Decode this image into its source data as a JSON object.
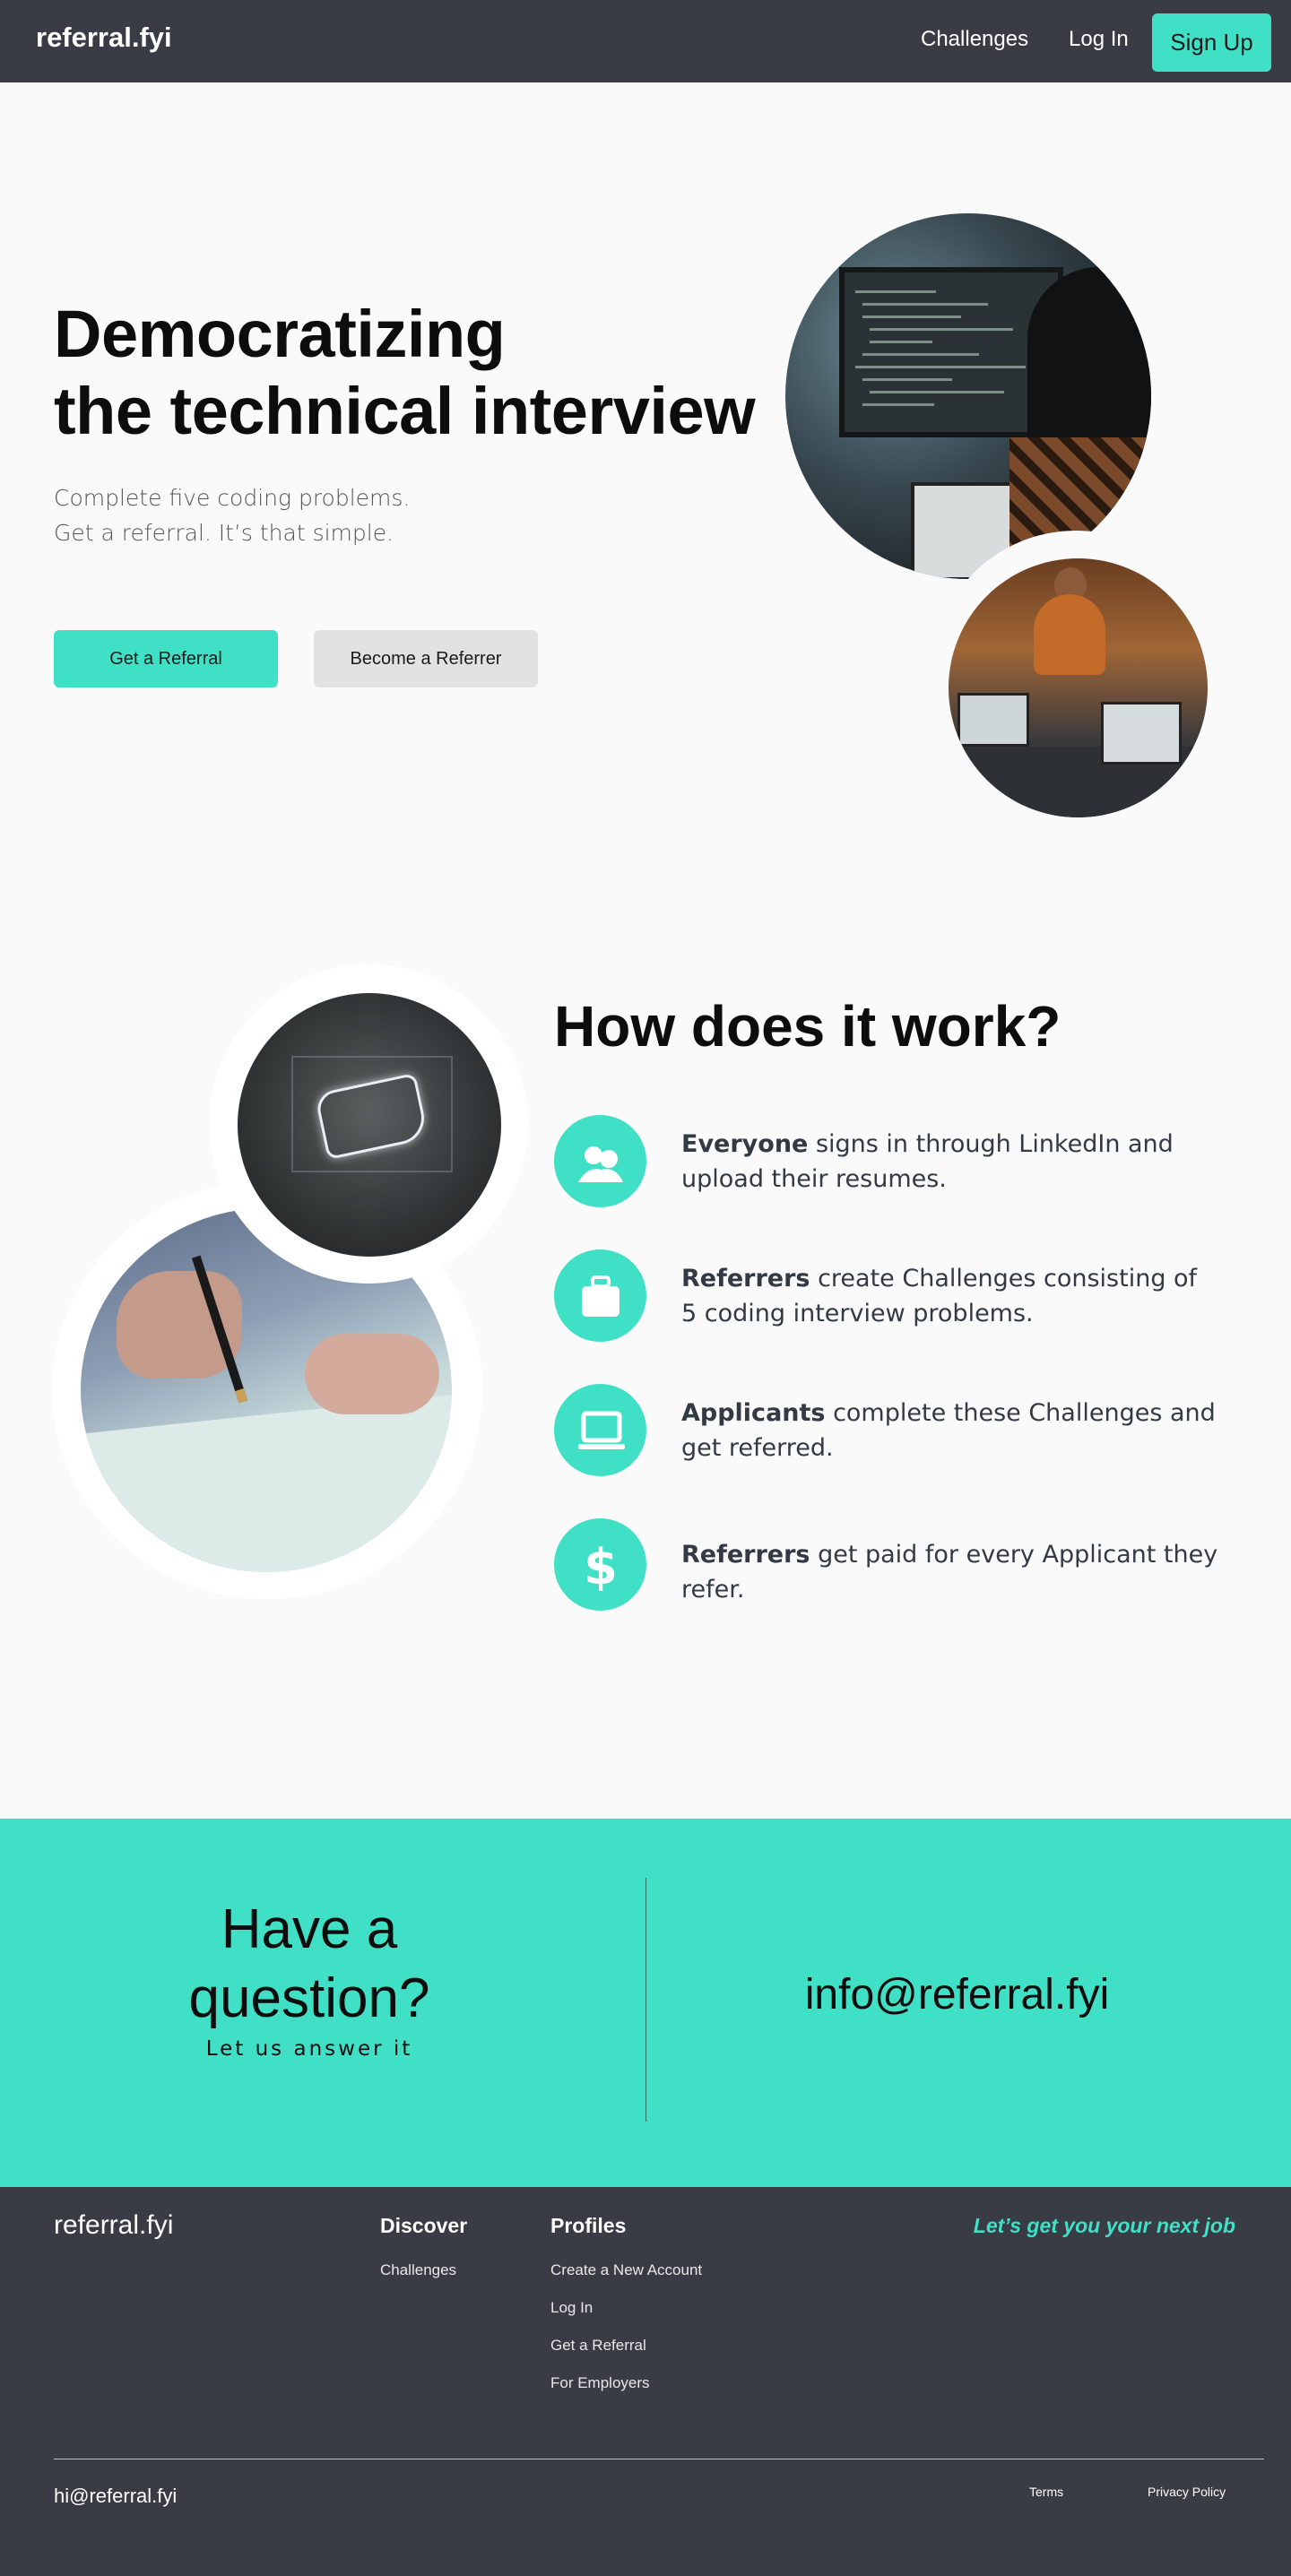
{
  "nav": {
    "brand": "referral.fyi",
    "challenges": "Challenges",
    "login": "Log In",
    "signup": "Sign Up"
  },
  "hero": {
    "title_line1": "Democratizing",
    "title_line2": "the technical interview",
    "sub_line1": "Complete five coding problems.",
    "sub_line2": "Get a referral. It’s that simple.",
    "btn_primary": "Get a Referral",
    "btn_secondary": "Become a Referrer"
  },
  "how": {
    "title": "How does it work?",
    "steps": [
      {
        "icon": "people-icon",
        "bold": "Everyone",
        "text": " signs in through LinkedIn and upload their resumes."
      },
      {
        "icon": "briefcase-icon",
        "bold": "Referrers",
        "text": " create Challenges consisting of 5 coding interview problems."
      },
      {
        "icon": "laptop-icon",
        "bold": "Applicants",
        "text": " complete these Challenges and get referred."
      },
      {
        "icon": "dollar-icon",
        "bold": "Referrers",
        "text": " get paid for every Applicant they refer."
      }
    ]
  },
  "question": {
    "title_line1": "Have a",
    "title_line2": "question?",
    "sub": "Let us answer it",
    "email": "info@referral.fyi"
  },
  "footer": {
    "brand": "referral.fyi",
    "discover_heading": "Discover",
    "discover_links": [
      "Challenges"
    ],
    "profiles_heading": "Profiles",
    "profiles_links": [
      "Create a New Account",
      "Log In",
      "Get a Referral",
      "For Employers"
    ],
    "tagline": "Let’s get you your next job",
    "email": "hi@referral.fyi",
    "terms": "Terms",
    "privacy": "Privacy Policy"
  },
  "colors": {
    "accent": "#3fe0c5",
    "dark": "#393c45",
    "background": "#fafafa"
  }
}
